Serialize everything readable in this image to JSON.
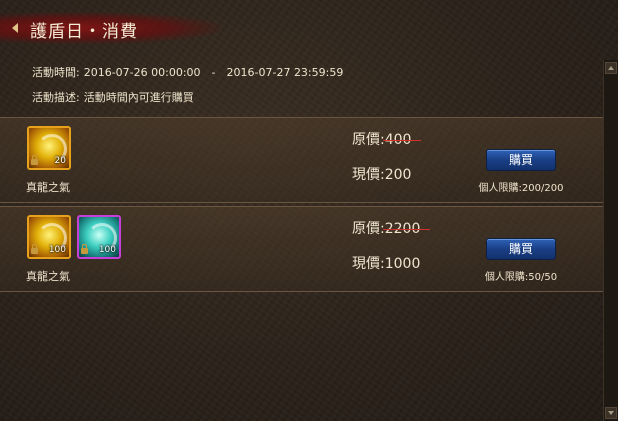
{
  "header": {
    "title": "護盾日・消費"
  },
  "event": {
    "time_label": "活動時間:",
    "time_value": "2016-07-26 00:00:00　-　2016-07-27 23:59:59",
    "desc_label": "活動描述:",
    "desc_value": "活動時間內可進行購買"
  },
  "offers": [
    {
      "items": [
        {
          "count": "20",
          "color": "#e2b10a"
        }
      ],
      "item_name": "真龍之氣",
      "original_label": "原價:",
      "original_value": "400",
      "current_label": "現價:",
      "current_value": "200",
      "buy_label": "購買",
      "limit_text": "個人限購:200/200"
    },
    {
      "items": [
        {
          "count": "100",
          "color": "#e2b10a"
        },
        {
          "count": "100",
          "color": "#3fd0c2"
        }
      ],
      "item_name": "真龍之氣",
      "original_label": "原價:",
      "original_value": "2200",
      "current_label": "現價:",
      "current_value": "1000",
      "buy_label": "購買",
      "limit_text": "個人限購:50/50"
    }
  ],
  "colors": {
    "strike": "#d2302a",
    "button": "#1a3f86",
    "title_ribbon": "#821414"
  }
}
